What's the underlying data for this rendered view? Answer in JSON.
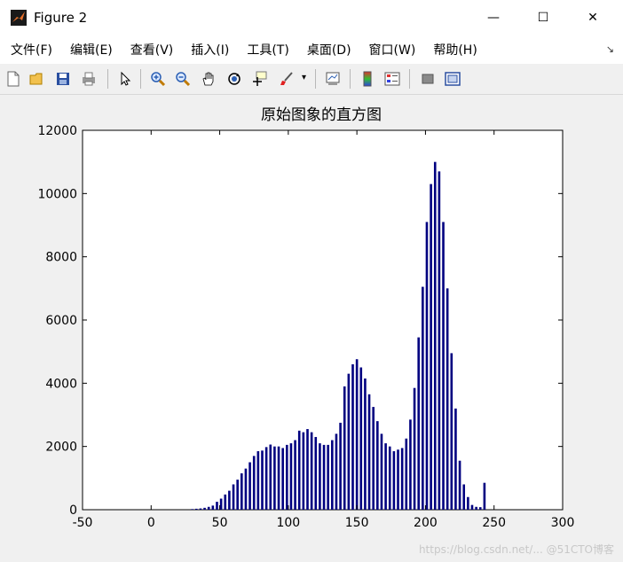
{
  "window": {
    "title": "Figure 2",
    "minimize_glyph": "—",
    "maximize_glyph": "☐",
    "close_glyph": "✕"
  },
  "menu": [
    "文件(F)",
    "编辑(E)",
    "查看(V)",
    "插入(I)",
    "工具(T)",
    "桌面(D)",
    "窗口(W)",
    "帮助(H)"
  ],
  "menu_overflow_glyph": "↘",
  "toolbar": {
    "icons": [
      "new-figure-icon",
      "open-file-icon",
      "save-icon",
      "print-icon",
      "pointer-icon",
      "zoom-in-icon",
      "zoom-out-icon",
      "pan-hand-icon",
      "rotate-3d-icon",
      "data-cursor-icon",
      "brush-icon",
      "link-plot-icon",
      "colorbar-icon",
      "legend-icon",
      "hide-plot-tools-icon",
      "show-plot-tools-icon"
    ],
    "brush_dropdown_glyph": "▾"
  },
  "watermark": "https://blog.csdn.net/... @51CTO博客",
  "colors": {
    "bar": "#000080",
    "axes_bg": "#ffffff",
    "figure_bg": "#f0f0f0"
  },
  "chart_data": {
    "type": "bar",
    "title": "原始图象的直方图",
    "xlabel": "",
    "ylabel": "",
    "xlim": [
      -50,
      300
    ],
    "ylim": [
      0,
      12000
    ],
    "xticks": [
      -50,
      0,
      50,
      100,
      150,
      200,
      250,
      300
    ],
    "yticks": [
      0,
      2000,
      4000,
      6000,
      8000,
      10000,
      12000
    ],
    "grid": false,
    "x": [
      30,
      33,
      36,
      39,
      42,
      45,
      48,
      51,
      54,
      57,
      60,
      63,
      66,
      69,
      72,
      75,
      78,
      81,
      84,
      87,
      90,
      93,
      96,
      99,
      102,
      105,
      108,
      111,
      114,
      117,
      120,
      123,
      126,
      129,
      132,
      135,
      138,
      141,
      144,
      147,
      150,
      153,
      156,
      159,
      162,
      165,
      168,
      171,
      174,
      177,
      180,
      183,
      186,
      189,
      192,
      195,
      198,
      201,
      204,
      207,
      210,
      213,
      216,
      219,
      222,
      225,
      228,
      231,
      234,
      237,
      240,
      243,
      246,
      249,
      252,
      255
    ],
    "values": [
      20,
      30,
      40,
      60,
      90,
      130,
      250,
      350,
      480,
      600,
      800,
      950,
      1150,
      1300,
      1500,
      1700,
      1850,
      1870,
      1980,
      2060,
      2000,
      2000,
      1950,
      2050,
      2100,
      2200,
      2500,
      2450,
      2550,
      2450,
      2300,
      2100,
      2050,
      2050,
      2200,
      2400,
      2750,
      3900,
      4300,
      4600,
      4760,
      4500,
      4150,
      3650,
      3250,
      2800,
      2400,
      2100,
      2000,
      1850,
      1900,
      1950,
      2250,
      2850,
      3850,
      5450,
      7050,
      9100,
      10300,
      11000,
      10700,
      9100,
      7000,
      4950,
      3200,
      1550,
      800,
      400,
      150,
      90,
      80,
      850
    ]
  }
}
